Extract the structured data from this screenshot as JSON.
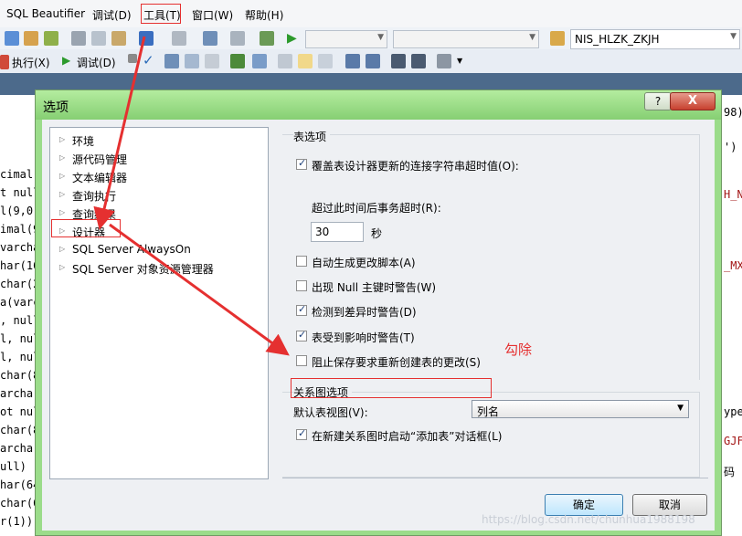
{
  "menubar": {
    "items": [
      "SQL Beautifier",
      "调试(D)",
      "工具(T)",
      "窗口(W)",
      "帮助(H)"
    ]
  },
  "toolbar1": {
    "db_combo": "NIS_HLZK_ZKJH"
  },
  "toolbar2": {
    "execute": "执行(X)",
    "debug": "调试(D)"
  },
  "left_code": [
    "cimal(9",
    "t null)",
    "l(9,0)),",
    "imal(9",
    "varcha",
    "har(16",
    "char(2",
    "a(varch",
    ", null)",
    "l, null)",
    "l, null)",
    "char(8",
    "archar(",
    "ot null)",
    "char(8",
    "archar",
    "ull)",
    "har(64)",
    "char(64",
    "r(1)), r"
  ],
  "right_code": [
    "98)",
    "')",
    "H_N",
    "_MX",
    "ype",
    "GJF",
    "码"
  ],
  "dialog": {
    "title": "选项",
    "help": "?",
    "close": "X",
    "tree": [
      "环境",
      "源代码管理",
      "文本编辑器",
      "查询执行",
      "查询结果",
      "设计器",
      "SQL Server AlwaysOn",
      "SQL Server 对象资源管理器"
    ],
    "table_options": {
      "title": "表选项",
      "override_timeout": "覆盖表设计器更新的连接字符串超时值(O):",
      "timeout_label": "超过此时间后事务超时(R):",
      "timeout_value": "30",
      "timeout_unit": "秒",
      "auto_script": "自动生成更改脚本(A)",
      "null_pk_warn": "出现 Null 主键时警告(W)",
      "diff_warn": "检测到差异时警告(D)",
      "affect_warn": "表受到影响时警告(T)",
      "prevent_save": "阻止保存要求重新创建表的更改(S)"
    },
    "diagram_options": {
      "title": "关系图选项",
      "default_view_label": "默认表视图(V):",
      "default_view_value": "列名",
      "add_table_dialog": "在新建关系图时启动“添加表”对话框(L)"
    },
    "ok": "确定",
    "cancel": "取消"
  },
  "annotation": "勾除",
  "watermark": "https://blog.csdn.net/chunhua1988198"
}
